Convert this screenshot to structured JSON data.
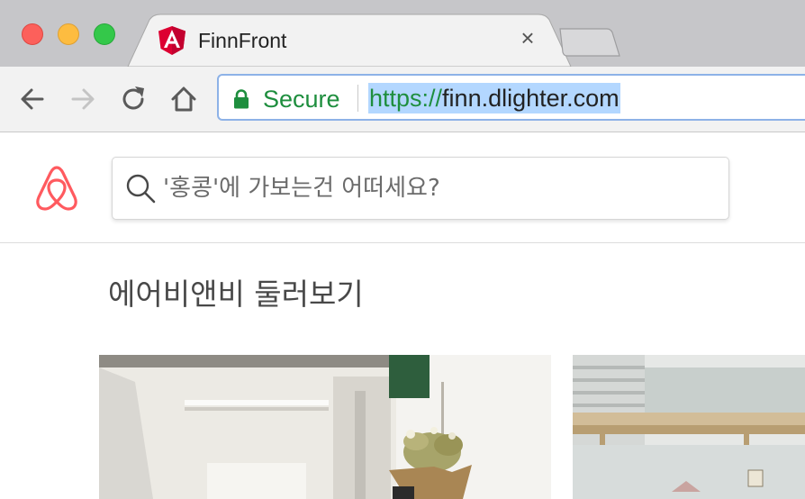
{
  "browser": {
    "tab": {
      "title": "FinnFront",
      "favicon": "angular-icon",
      "close_glyph": "×"
    },
    "toolbar": {
      "back": "back-arrow-icon",
      "forward": "forward-arrow-icon",
      "reload": "reload-icon",
      "home": "home-icon"
    },
    "omnibox": {
      "security_label": "Secure",
      "url_scheme": "https://",
      "url_host": "finn.dlighter.com"
    }
  },
  "page": {
    "logo": "airbnb-logo-icon",
    "search": {
      "placeholder": "'홍콩'에 가보는건 어떠세요?"
    },
    "section_title": "에어비앤비 둘러보기",
    "cards": [
      {
        "image": "room-photo-1"
      },
      {
        "image": "room-photo-2"
      }
    ]
  },
  "colors": {
    "secure_green": "#1e8e3e",
    "brand": "#ff5a5f",
    "url_selection": "#b3d7ff",
    "angular_red": "#dd0031"
  }
}
